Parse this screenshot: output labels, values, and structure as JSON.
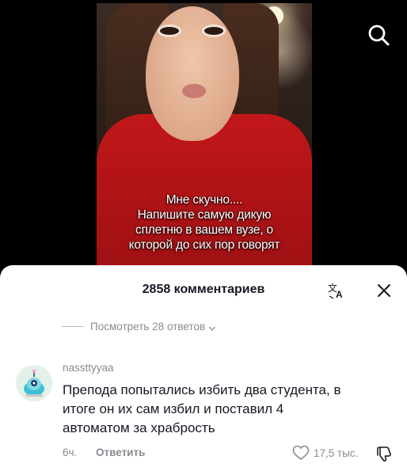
{
  "video": {
    "caption_lines": [
      "Мне скучно....",
      "Напишите самую дикую",
      "сплетню в вашем вузе, о",
      "которой до сих пор говорят"
    ],
    "icon": "search-icon"
  },
  "comments": {
    "title": "2858 комментариев",
    "translate_icon": "translate-icon",
    "close_icon": "close-icon",
    "view_replies": "Посмотреть 28 ответов",
    "comment": {
      "username": "nassttyyaa",
      "text_lines": [
        "Препода попытались избить два студента, в",
        "итоге он их сам избил и поставил 4",
        "автоматом за храбрость"
      ],
      "time": "6ч.",
      "reply_label": "Ответить",
      "likes": "17,5 тыс."
    }
  }
}
